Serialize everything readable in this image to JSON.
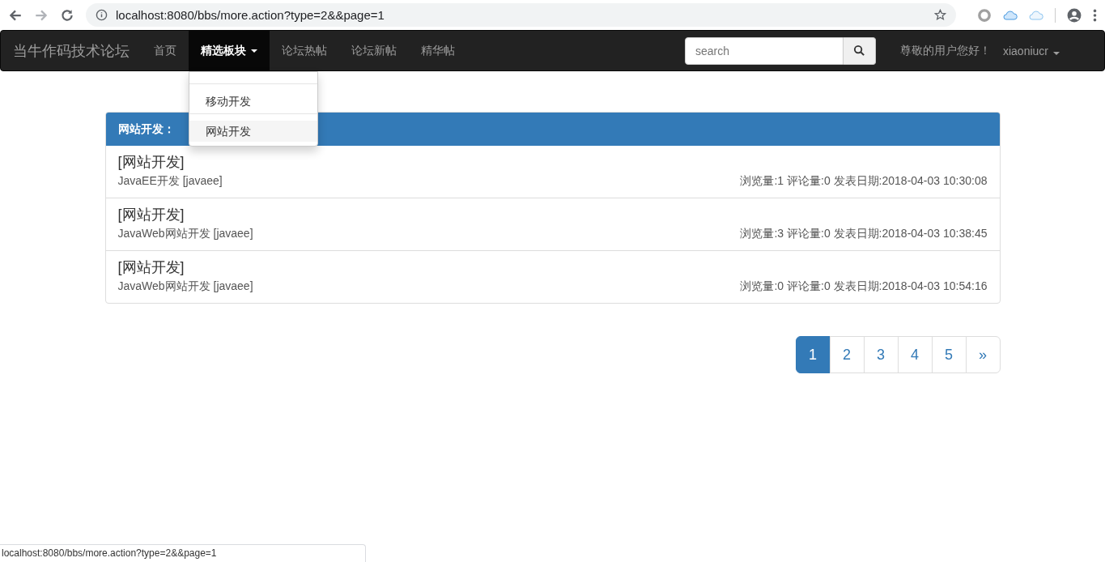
{
  "browser": {
    "url": "localhost:8080/bbs/more.action?type=2&&page=1"
  },
  "navbar": {
    "brand": "当牛作码技术论坛",
    "items": [
      {
        "label": "首页",
        "selected": false,
        "dropdown": false
      },
      {
        "label": "精选板块",
        "selected": true,
        "dropdown": true
      },
      {
        "label": "论坛热帖",
        "selected": false,
        "dropdown": false
      },
      {
        "label": "论坛新帖",
        "selected": false,
        "dropdown": false
      },
      {
        "label": "精华帖",
        "selected": false,
        "dropdown": false
      }
    ],
    "search": {
      "placeholder": "search"
    },
    "greeting": "尊敬的用户您好！",
    "user": "xiaoniucr"
  },
  "dropdown_menu": [
    {
      "label": "移动开发",
      "selected": false
    },
    {
      "label": "网站开发",
      "selected": true
    }
  ],
  "panel": {
    "title": "网站开发：",
    "posts": [
      {
        "category": "[网站开发]",
        "title": "JavaEE开发 [javaee]",
        "stats": "浏览量:1 评论量:0 发表日期:2018-04-03 10:30:08"
      },
      {
        "category": "[网站开发]",
        "title": "JavaWeb网站开发 [javaee]",
        "stats": "浏览量:3 评论量:0 发表日期:2018-04-03 10:38:45"
      },
      {
        "category": "[网站开发]",
        "title": "JavaWeb网站开发 [javaee]",
        "stats": "浏览量:0 评论量:0 发表日期:2018-04-03 10:54:16"
      }
    ]
  },
  "pagination": [
    {
      "label": "1",
      "selected": true
    },
    {
      "label": "2",
      "selected": false
    },
    {
      "label": "3",
      "selected": false
    },
    {
      "label": "4",
      "selected": false
    },
    {
      "label": "5",
      "selected": false
    },
    {
      "label": "»",
      "selected": false
    }
  ],
  "status_bar": "localhost:8080/bbs/more.action?type=2&&page=1"
}
